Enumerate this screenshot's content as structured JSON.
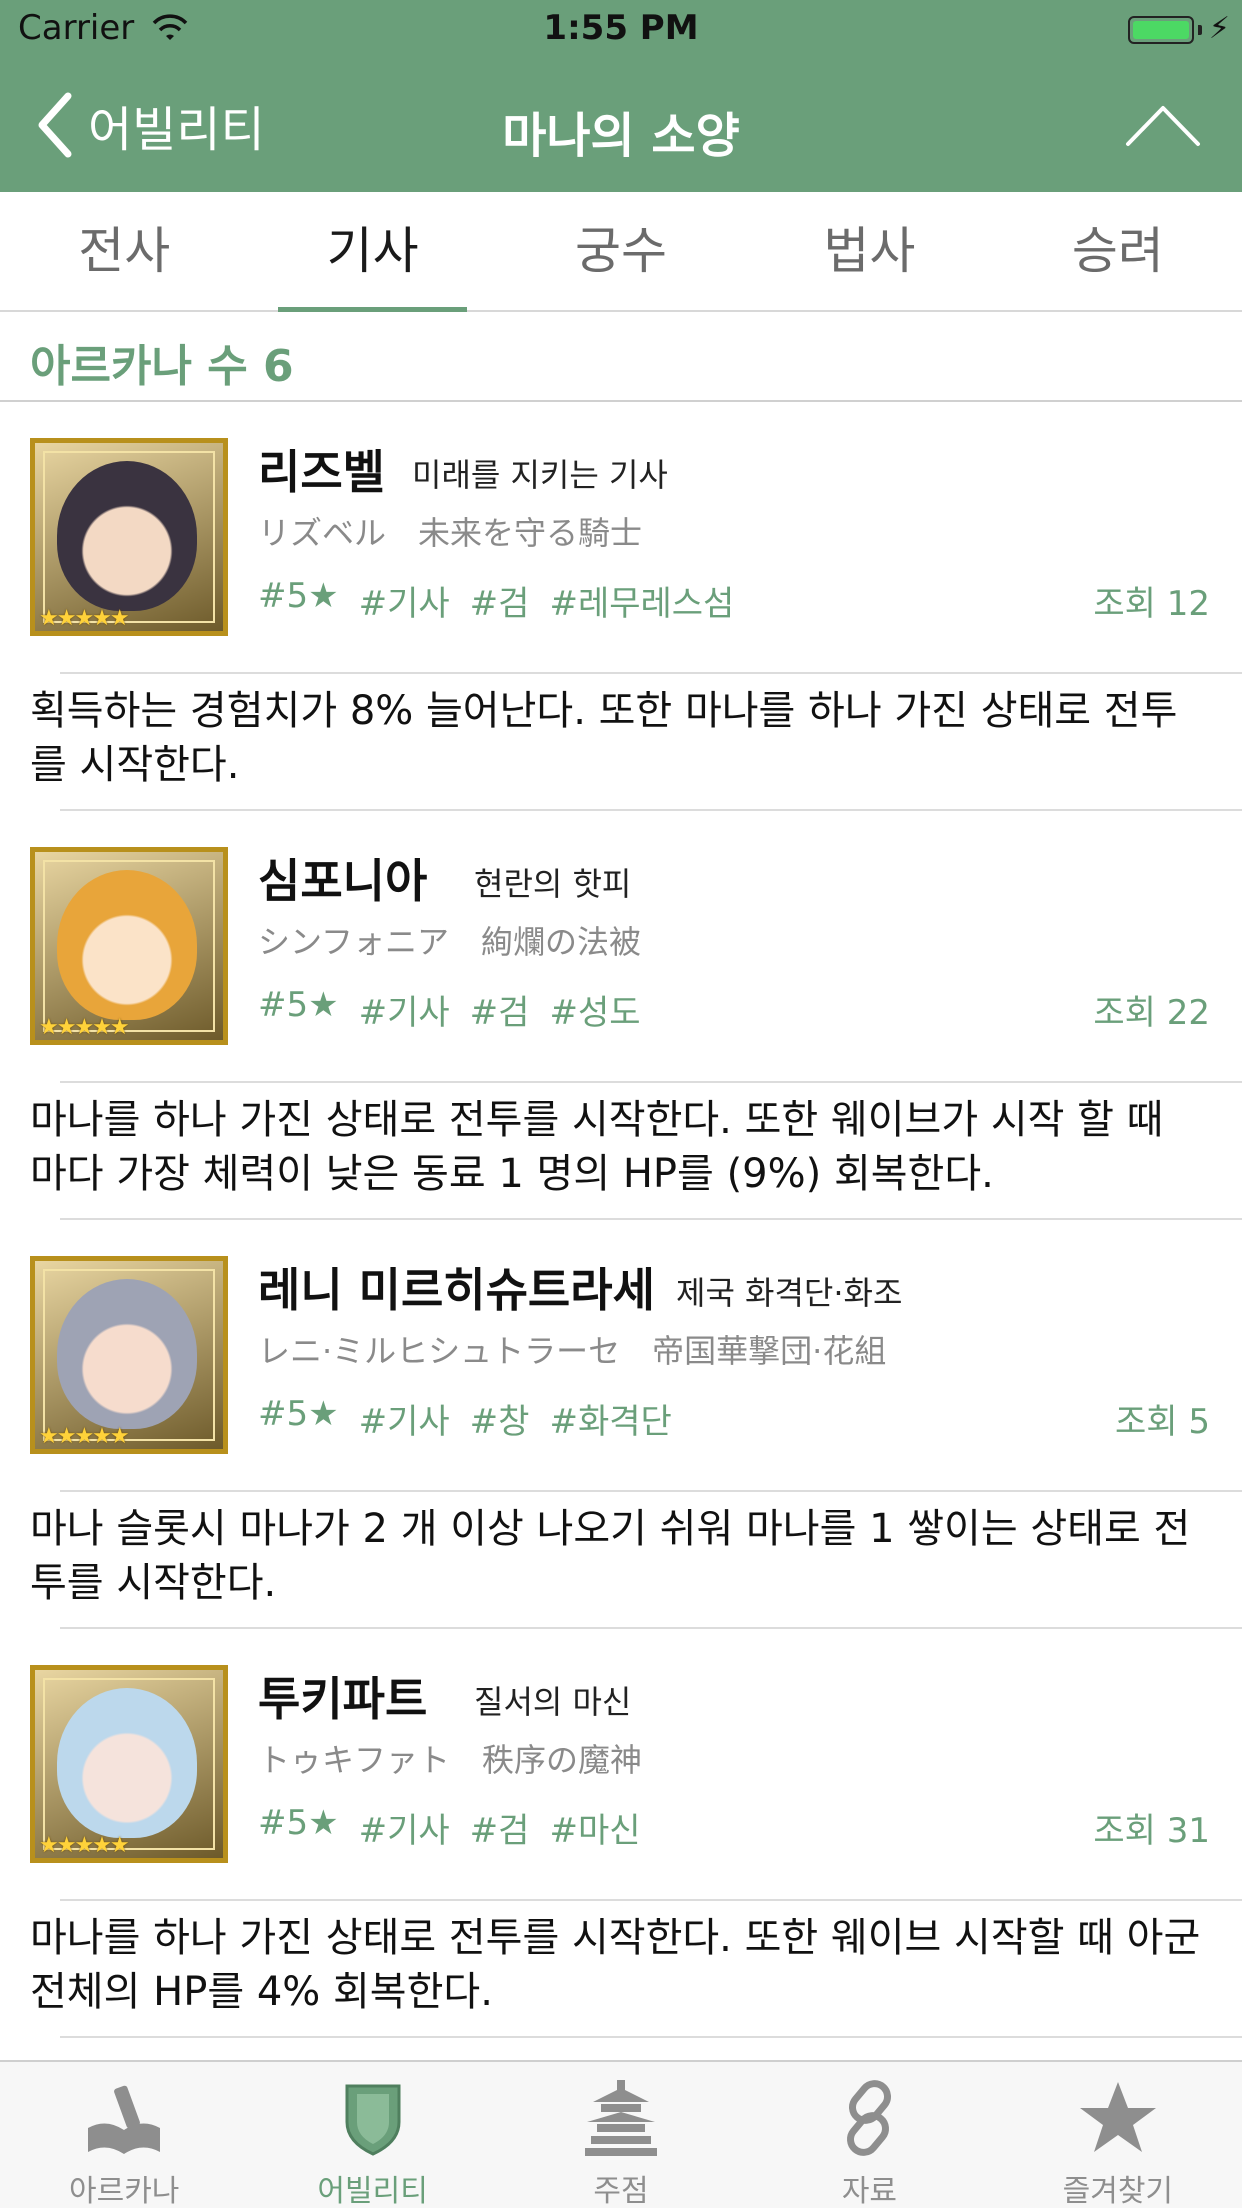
{
  "status": {
    "carrier": "Carrier",
    "time": "1:55 PM",
    "battery_level": 1.0
  },
  "nav": {
    "back_label": "어빌리티",
    "title": "마나의 소양"
  },
  "tabs": [
    {
      "label": "전사",
      "active": false
    },
    {
      "label": "기사",
      "active": true
    },
    {
      "label": "궁수",
      "active": false
    },
    {
      "label": "법사",
      "active": false
    },
    {
      "label": "승려",
      "active": false
    }
  ],
  "count_label": "아르카나 수 6",
  "items": [
    {
      "name": "리즈벨",
      "subtitle": "미래를 지키는 기사",
      "jp": "リズベル　未来を守る騎士",
      "tags": [
        "#5★",
        "#기사",
        "#검",
        "#레무레스섬"
      ],
      "views": "조회 12",
      "desc": "획득하는 경험치가 8% 늘어난다. 또한 마나를 하나 가진 상태로 전투를 시작한다.",
      "thumb_colors": [
        "#3a3340",
        "#f3d9c4"
      ]
    },
    {
      "name": "심포니아",
      "subtitle": "현란의 핫피",
      "jp": "シンフォニア　絢爛の法被",
      "tags": [
        "#5★",
        "#기사",
        "#검",
        "#성도"
      ],
      "views": "조회 22",
      "desc": "마나를 하나 가진 상태로 전투를 시작한다. 또한 웨이브가 시작 할 때 마다 가장 체력이 낮은 동료 1 명의 HP를 (9%) 회복한다.",
      "thumb_colors": [
        "#e8a53a",
        "#fbe3c8"
      ]
    },
    {
      "name": "레니 미르히슈트라세",
      "subtitle": "제국 화격단·화조",
      "jp": "レニ·ミルヒシュトラーセ　帝国華撃団·花組",
      "tags": [
        "#5★",
        "#기사",
        "#창",
        "#화격단"
      ],
      "views": "조회 5",
      "desc": "마나 슬롯시 마나가 2 개 이상 나오기 쉬워 마나를 1 쌓이는 상태로 전투를 시작한다.",
      "thumb_colors": [
        "#9ea3b4",
        "#f6dccd"
      ]
    },
    {
      "name": "투키파트",
      "subtitle": "질서의 마신",
      "jp": "トゥキファト　秩序の魔神",
      "tags": [
        "#5★",
        "#기사",
        "#검",
        "#마신"
      ],
      "views": "조회 31",
      "desc": "마나를 하나 가진 상태로 전투를 시작한다. 또한 웨이브 시작할 때 아군 전체의 HP를 4% 회복한다.",
      "thumb_colors": [
        "#bcd8ec",
        "#f5e3dc"
      ]
    }
  ],
  "tabbar": [
    {
      "label": "아르카나",
      "icon": "book-icon",
      "active": false
    },
    {
      "label": "어빌리티",
      "icon": "shield-icon",
      "active": true
    },
    {
      "label": "주점",
      "icon": "pagoda-icon",
      "active": false
    },
    {
      "label": "자료",
      "icon": "link-icon",
      "active": false
    },
    {
      "label": "즐겨찾기",
      "icon": "star-icon",
      "active": false
    }
  ],
  "colors": {
    "accent": "#6a9f7a",
    "inactive": "#8e8e8e"
  }
}
